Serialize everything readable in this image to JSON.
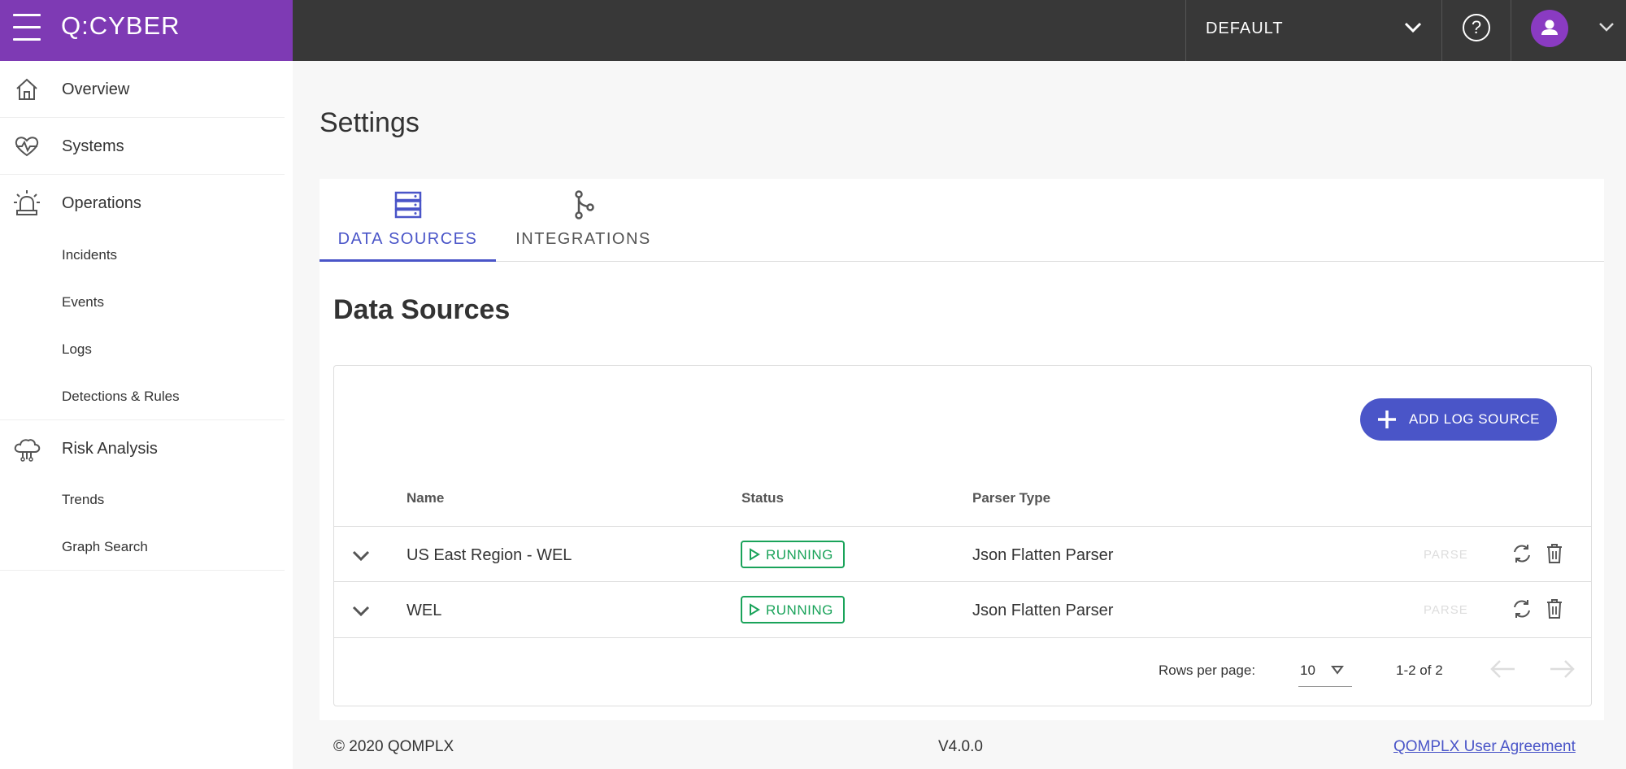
{
  "header": {
    "logo": "Q:CYBER",
    "environment": "DEFAULT",
    "help_symbol": "?"
  },
  "sidebar": {
    "items": [
      {
        "label": "Overview",
        "icon": "home-icon"
      },
      {
        "label": "Systems",
        "icon": "heart-pulse-icon"
      },
      {
        "label": "Operations",
        "icon": "alarm-light-icon",
        "children": [
          "Incidents",
          "Events",
          "Logs",
          "Detections & Rules"
        ]
      },
      {
        "label": "Risk Analysis",
        "icon": "cloud-network-icon",
        "children": [
          "Trends",
          "Graph Search"
        ]
      }
    ]
  },
  "page": {
    "title": "Settings"
  },
  "tabs": [
    {
      "label": "DATA SOURCES",
      "icon": "server-icon",
      "active": true
    },
    {
      "label": "INTEGRATIONS",
      "icon": "git-branch-icon",
      "active": false
    }
  ],
  "data_sources": {
    "title": "Data Sources",
    "add_button": "ADD LOG SOURCE",
    "columns": [
      "Name",
      "Status",
      "Parser Type"
    ],
    "rows": [
      {
        "name": "US East Region - WEL",
        "status": "RUNNING",
        "parser": "Json Flatten Parser",
        "action": "PARSE"
      },
      {
        "name": "WEL",
        "status": "RUNNING",
        "parser": "Json Flatten Parser",
        "action": "PARSE"
      }
    ],
    "pagination": {
      "rows_per_page_label": "Rows per page:",
      "rows_per_page": "10",
      "range": "1-2 of 2"
    }
  },
  "footer": {
    "copyright": "© 2020 QOMPLX",
    "version": "V4.0.0",
    "agreement_link": "QOMPLX User Agreement"
  },
  "colors": {
    "brand_purple": "#7e3ab4",
    "topbar": "#383838",
    "accent_blue": "#4a55c8",
    "status_green": "#1aa35a"
  }
}
